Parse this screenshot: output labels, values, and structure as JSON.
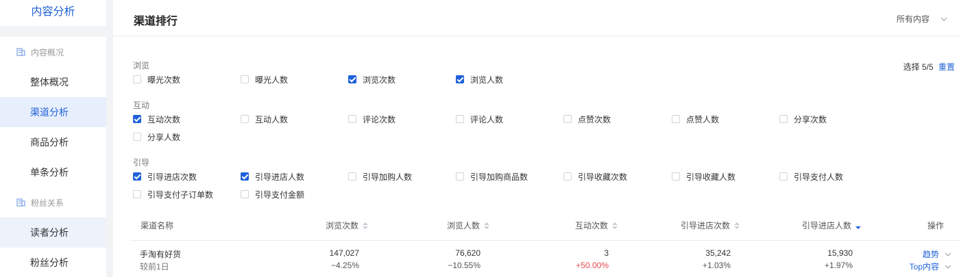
{
  "sidebar": {
    "title": "内容分析",
    "groups": [
      {
        "label": "内容概况",
        "icon": "building-icon"
      },
      {
        "label": "粉丝关系",
        "icon": "building-icon"
      }
    ],
    "items": [
      {
        "label": "整体概况"
      },
      {
        "label": "渠道分析"
      },
      {
        "label": "商品分析"
      },
      {
        "label": "单条分析"
      },
      {
        "label": "读者分析"
      },
      {
        "label": "粉丝分析"
      }
    ],
    "active_item": "渠道分析"
  },
  "header": {
    "title": "渠道排行",
    "scope_select": {
      "value": "所有内容",
      "icon": "chevron-down-icon"
    }
  },
  "selection": {
    "count_text": "选择 5/5",
    "reset_label": "重置"
  },
  "filters": {
    "browse": {
      "label": "浏览",
      "options": [
        {
          "label": "曝光次数",
          "checked": false
        },
        {
          "label": "曝光人数",
          "checked": false
        },
        {
          "label": "浏览次数",
          "checked": true
        },
        {
          "label": "浏览人数",
          "checked": true
        }
      ]
    },
    "interact": {
      "label": "互动",
      "options": [
        {
          "label": "互动次数",
          "checked": true
        },
        {
          "label": "互动人数",
          "checked": false
        },
        {
          "label": "评论次数",
          "checked": false
        },
        {
          "label": "评论人数",
          "checked": false
        },
        {
          "label": "点赞次数",
          "checked": false
        },
        {
          "label": "点赞人数",
          "checked": false
        },
        {
          "label": "分享次数",
          "checked": false
        },
        {
          "label": "分享人数",
          "checked": false
        }
      ]
    },
    "guide": {
      "label": "引导",
      "options": [
        {
          "label": "引导进店次数",
          "checked": true
        },
        {
          "label": "引导进店人数",
          "checked": true
        },
        {
          "label": "引导加购人数",
          "checked": false
        },
        {
          "label": "引导加购商品数",
          "checked": false
        },
        {
          "label": "引导收藏次数",
          "checked": false
        },
        {
          "label": "引导收藏人数",
          "checked": false
        },
        {
          "label": "引导支付人数",
          "checked": false
        },
        {
          "label": "引导支付子订单数",
          "checked": false
        },
        {
          "label": "引导支付金额",
          "checked": false
        }
      ]
    }
  },
  "table": {
    "columns": [
      "渠道名称",
      "浏览次数",
      "浏览人数",
      "互动次数",
      "引导进店次数",
      "引导进店人数",
      "操作"
    ],
    "sorted_column": "引导进店人数",
    "sort_direction": "desc",
    "rows": [
      {
        "name": "手淘有好货",
        "sub": "较前1日",
        "values": [
          "147,027",
          "76,620",
          "3",
          "35,242",
          "15,930"
        ],
        "changes": [
          "−4.25%",
          "−10.55%",
          "+50.00%",
          "+1.03%",
          "+1.97%"
        ],
        "change_colors": [
          "#555555",
          "#555555",
          "#e5484d",
          "#555555",
          "#555555"
        ],
        "actions": [
          "趋势",
          "Top内容"
        ]
      }
    ]
  },
  "colors": {
    "accent": "#1f62d9",
    "positive_highlight": "#e5484d"
  }
}
